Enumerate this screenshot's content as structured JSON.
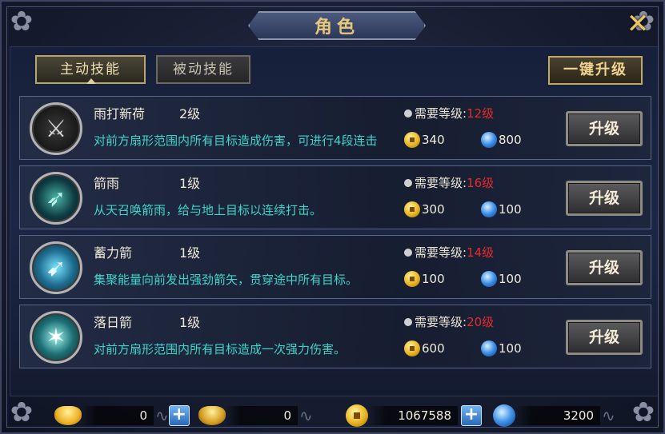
{
  "window": {
    "title": "角色",
    "close_icon": "close-x-icon"
  },
  "tabs": [
    {
      "label": "主动技能",
      "active": true
    },
    {
      "label": "被动技能",
      "active": false
    }
  ],
  "upgrade_all_label": "一键升级",
  "skill_requirement_label": "需要等级:",
  "upgrade_button_label": "升级",
  "skills": [
    {
      "name": "雨打新荷",
      "level": "2级",
      "description": "对前方扇形范围内所有目标造成伤害，可进行4段连击",
      "required_level": "12级",
      "gold_cost": "340",
      "gem_cost": "800",
      "icon": "sword-icon"
    },
    {
      "name": "箭雨",
      "level": "1级",
      "description": "从天召唤箭雨，给与地上目标以连续打击。",
      "required_level": "16级",
      "gold_cost": "300",
      "gem_cost": "100",
      "icon": "arrow-rain-icon"
    },
    {
      "name": "蓄力箭",
      "level": "1级",
      "description": "集聚能量向前发出强劲箭矢，贯穿途中所有目标。",
      "required_level": "14级",
      "gold_cost": "100",
      "gem_cost": "100",
      "icon": "charged-arrow-icon"
    },
    {
      "name": "落日箭",
      "level": "1级",
      "description": "对前方扇形范围内所有目标造成一次强力伤害。",
      "required_level": "20级",
      "gold_cost": "600",
      "gem_cost": "100",
      "icon": "sunset-arrow-icon"
    }
  ],
  "resources": {
    "ingot": "0",
    "bound_ingot": "0",
    "gold": "1067588",
    "gem": "3200"
  },
  "colors": {
    "title_gold": "#e7c77a",
    "desc_cyan": "#3fd3c9",
    "required_red": "#e62b2b"
  }
}
